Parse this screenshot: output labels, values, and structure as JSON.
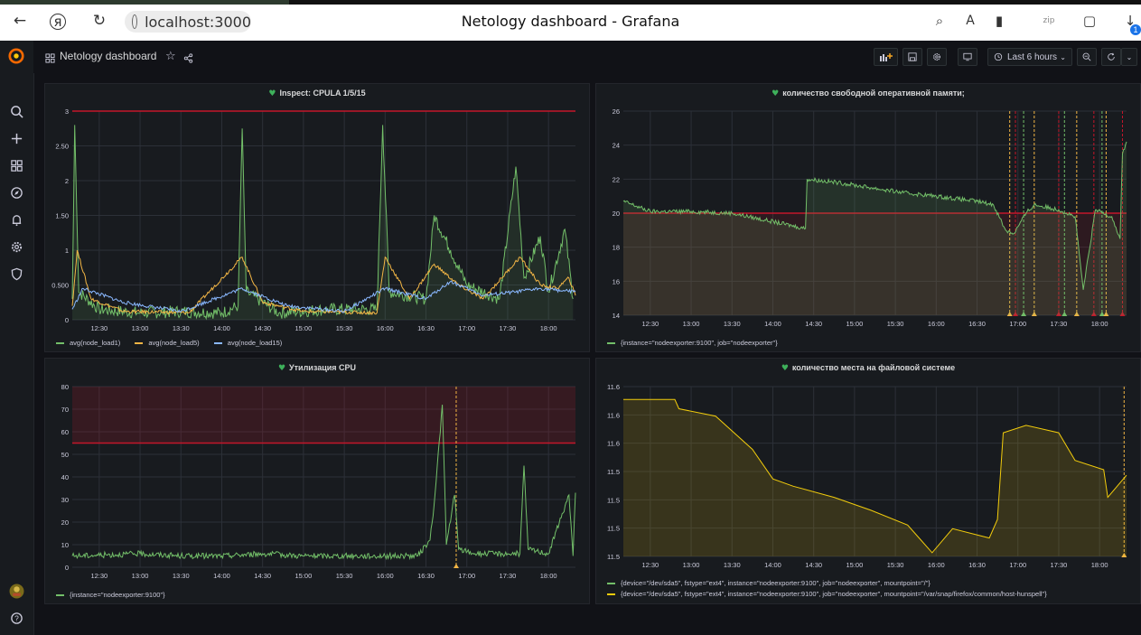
{
  "browser": {
    "url": "localhost:3000",
    "title": "Netology dashboard - Grafana",
    "download_badge": "1"
  },
  "dashboard": {
    "title": "Netology dashboard",
    "time_range": "Last 6 hours"
  },
  "colors": {
    "green": "#73bf69",
    "yellow": "#f2cc0c",
    "orange": "#f2b545",
    "blue": "#8ab8ff",
    "red": "#c4162a",
    "panel_bg": "#181b1f",
    "grid": "#2c3038"
  },
  "panels": [
    {
      "id": "cpula",
      "title": "Inspect: CPULA 1/5/15",
      "legend": [
        "avg(node_load1)",
        "avg(node_load5)",
        "avg(node_load15)"
      ]
    },
    {
      "id": "memory",
      "title": "количество свободной оперативной памяти;",
      "legend": [
        "{instance=\"nodeexporter:9100\", job=\"nodeexporter\"}"
      ]
    },
    {
      "id": "cpu",
      "title": "Утилизация CPU",
      "legend": [
        "{instance=\"nodeexporter:9100\"}"
      ]
    },
    {
      "id": "disk",
      "title": "количество места на файловой системе",
      "legend": [
        "{device=\"/dev/sda5\", fstype=\"ext4\", instance=\"nodeexporter:9100\", job=\"nodeexporter\", mountpoint=\"/\"}",
        "{device=\"/dev/sda5\", fstype=\"ext4\", instance=\"nodeexporter:9100\", job=\"nodeexporter\", mountpoint=\"/var/snap/firefox/common/host-hunspell\"}"
      ]
    }
  ],
  "chart_data": [
    {
      "type": "line",
      "panel": "cpula",
      "x_ticks": [
        "12:30",
        "13:00",
        "13:30",
        "14:00",
        "14:30",
        "15:00",
        "15:30",
        "16:00",
        "16:30",
        "17:00",
        "17:30",
        "18:00"
      ],
      "y_ticks": [
        "0",
        "0.500",
        "1",
        "1.50",
        "2",
        "2.50",
        "3"
      ],
      "ylim": [
        0,
        3
      ],
      "threshold": 3,
      "series": [
        {
          "name": "avg(node_load1)",
          "color": "#73bf69",
          "values": [
            [
              12.17,
              0.3
            ],
            [
              12.2,
              2.8
            ],
            [
              12.25,
              0.4
            ],
            [
              12.5,
              0.15
            ],
            [
              13.0,
              0.1
            ],
            [
              13.5,
              0.12
            ],
            [
              14.0,
              0.1
            ],
            [
              14.2,
              0.2
            ],
            [
              14.25,
              2.75
            ],
            [
              14.3,
              0.4
            ],
            [
              14.7,
              0.1
            ],
            [
              15.3,
              0.15
            ],
            [
              15.9,
              0.15
            ],
            [
              15.97,
              2.8
            ],
            [
              16.05,
              0.4
            ],
            [
              16.5,
              0.3
            ],
            [
              16.6,
              1.5
            ],
            [
              16.8,
              1.0
            ],
            [
              17.0,
              0.5
            ],
            [
              17.4,
              0.3
            ],
            [
              17.6,
              2.2
            ],
            [
              17.7,
              0.6
            ],
            [
              17.9,
              1.2
            ],
            [
              18.0,
              0.4
            ],
            [
              18.2,
              1.3
            ],
            [
              18.3,
              0.3
            ]
          ]
        },
        {
          "name": "avg(node_load5)",
          "color": "#f2b545",
          "values": [
            [
              12.17,
              0.2
            ],
            [
              12.23,
              1.0
            ],
            [
              12.4,
              0.3
            ],
            [
              12.8,
              0.12
            ],
            [
              13.6,
              0.1
            ],
            [
              14.25,
              0.9
            ],
            [
              14.5,
              0.25
            ],
            [
              15.0,
              0.12
            ],
            [
              15.9,
              0.1
            ],
            [
              16.0,
              0.9
            ],
            [
              16.3,
              0.3
            ],
            [
              16.6,
              0.8
            ],
            [
              16.9,
              0.5
            ],
            [
              17.2,
              0.3
            ],
            [
              17.65,
              0.9
            ],
            [
              17.9,
              0.5
            ],
            [
              18.1,
              0.45
            ],
            [
              18.25,
              0.6
            ],
            [
              18.33,
              0.35
            ]
          ]
        },
        {
          "name": "avg(node_load15)",
          "color": "#8ab8ff",
          "values": [
            [
              12.17,
              0.15
            ],
            [
              12.3,
              0.45
            ],
            [
              12.8,
              0.25
            ],
            [
              13.5,
              0.12
            ],
            [
              14.25,
              0.45
            ],
            [
              14.8,
              0.2
            ],
            [
              15.5,
              0.12
            ],
            [
              16.0,
              0.45
            ],
            [
              16.5,
              0.3
            ],
            [
              16.8,
              0.55
            ],
            [
              17.2,
              0.35
            ],
            [
              17.6,
              0.4
            ],
            [
              17.9,
              0.45
            ],
            [
              18.33,
              0.4
            ]
          ]
        }
      ]
    },
    {
      "type": "area",
      "panel": "memory",
      "x_ticks": [
        "12:30",
        "13:00",
        "13:30",
        "14:00",
        "14:30",
        "15:00",
        "15:30",
        "16:00",
        "16:30",
        "17:00",
        "17:30",
        "18:00"
      ],
      "y_ticks": [
        "14",
        "16",
        "18",
        "20",
        "22",
        "24",
        "26"
      ],
      "ylim": [
        14,
        26
      ],
      "threshold": 20,
      "series": [
        {
          "name": "{instance=\"nodeexporter:9100\", job=\"nodeexporter\"}",
          "color": "#73bf69",
          "values": [
            [
              12.17,
              20.7
            ],
            [
              12.5,
              20.1
            ],
            [
              13.0,
              20.1
            ],
            [
              13.5,
              20.0
            ],
            [
              13.9,
              19.6
            ],
            [
              14.3,
              19.2
            ],
            [
              14.4,
              19.1
            ],
            [
              14.42,
              22.0
            ],
            [
              14.8,
              21.8
            ],
            [
              15.2,
              21.5
            ],
            [
              15.6,
              21.2
            ],
            [
              16.0,
              21.0
            ],
            [
              16.5,
              20.7
            ],
            [
              16.7,
              20.5
            ],
            [
              16.85,
              19.0
            ],
            [
              16.95,
              18.8
            ],
            [
              17.1,
              20.0
            ],
            [
              17.2,
              20.5
            ],
            [
              17.5,
              20.2
            ],
            [
              17.7,
              19.8
            ],
            [
              17.8,
              15.5
            ],
            [
              17.95,
              20.2
            ],
            [
              18.15,
              19.8
            ],
            [
              18.25,
              18.5
            ],
            [
              18.28,
              23.5
            ],
            [
              18.33,
              24.2
            ]
          ]
        }
      ],
      "annotations": [
        16.9,
        16.97,
        17.07,
        17.2,
        17.5,
        17.57,
        17.72,
        17.93,
        18.03,
        18.08,
        18.28
      ]
    },
    {
      "type": "line",
      "panel": "cpu",
      "x_ticks": [
        "12:30",
        "13:00",
        "13:30",
        "14:00",
        "14:30",
        "15:00",
        "15:30",
        "16:00",
        "16:30",
        "17:00",
        "17:30",
        "18:00"
      ],
      "y_ticks": [
        "0",
        "10",
        "20",
        "30",
        "40",
        "50",
        "60",
        "70",
        "80"
      ],
      "ylim": [
        0,
        80
      ],
      "threshold": 55,
      "series": [
        {
          "name": "{instance=\"nodeexporter:9100\"}",
          "color": "#73bf69",
          "values": [
            [
              12.17,
              5
            ],
            [
              13.0,
              6
            ],
            [
              13.5,
              5
            ],
            [
              14.0,
              5
            ],
            [
              14.5,
              6
            ],
            [
              15.0,
              5
            ],
            [
              15.5,
              5
            ],
            [
              16.0,
              5
            ],
            [
              16.4,
              5
            ],
            [
              16.55,
              12
            ],
            [
              16.6,
              28
            ],
            [
              16.7,
              72
            ],
            [
              16.75,
              10
            ],
            [
              16.85,
              32
            ],
            [
              16.9,
              8
            ],
            [
              17.1,
              6
            ],
            [
              17.5,
              6
            ],
            [
              17.65,
              6
            ],
            [
              17.7,
              45
            ],
            [
              17.75,
              8
            ],
            [
              18.0,
              6
            ],
            [
              18.25,
              32
            ],
            [
              18.3,
              5
            ],
            [
              18.33,
              33
            ]
          ]
        }
      ],
      "annotations": [
        16.87
      ]
    },
    {
      "type": "area",
      "panel": "disk",
      "x_ticks": [
        "12:30",
        "13:00",
        "13:30",
        "14:00",
        "14:30",
        "15:00",
        "15:30",
        "16:00",
        "16:30",
        "17:00",
        "17:30",
        "18:00"
      ],
      "y_ticks": [
        "11.5",
        "11.5",
        "11.5",
        "11.5",
        "11.6",
        "11.6",
        "11.6"
      ],
      "series": [
        {
          "name": "{device=\"/dev/sda5\", fstype=\"ext4\", instance=\"nodeexporter:9100\", job=\"nodeexporter\", mountpoint=\"/\"}",
          "color": "#73bf69",
          "values": []
        },
        {
          "name": "{device=\"/dev/sda5\", fstype=\"ext4\", instance=\"nodeexporter:9100\", job=\"nodeexporter\", mountpoint=\"/var/snap/firefox/common/host-hunspell\"}",
          "color": "#f2cc0c",
          "values": [
            [
              12.17,
              11.598
            ],
            [
              12.8,
              11.598
            ],
            [
              12.85,
              11.593
            ],
            [
              13.3,
              11.589
            ],
            [
              13.75,
              11.571
            ],
            [
              14.0,
              11.555
            ],
            [
              14.25,
              11.551
            ],
            [
              14.75,
              11.545
            ],
            [
              15.2,
              11.538
            ],
            [
              15.65,
              11.53
            ],
            [
              15.95,
              11.515
            ],
            [
              16.2,
              11.528
            ],
            [
              16.65,
              11.523
            ],
            [
              16.75,
              11.533
            ],
            [
              16.82,
              11.58
            ],
            [
              17.1,
              11.584
            ],
            [
              17.5,
              11.58
            ],
            [
              17.7,
              11.565
            ],
            [
              18.05,
              11.56
            ],
            [
              18.1,
              11.545
            ],
            [
              18.33,
              11.557
            ]
          ]
        }
      ],
      "annotations": [
        18.3
      ]
    }
  ]
}
